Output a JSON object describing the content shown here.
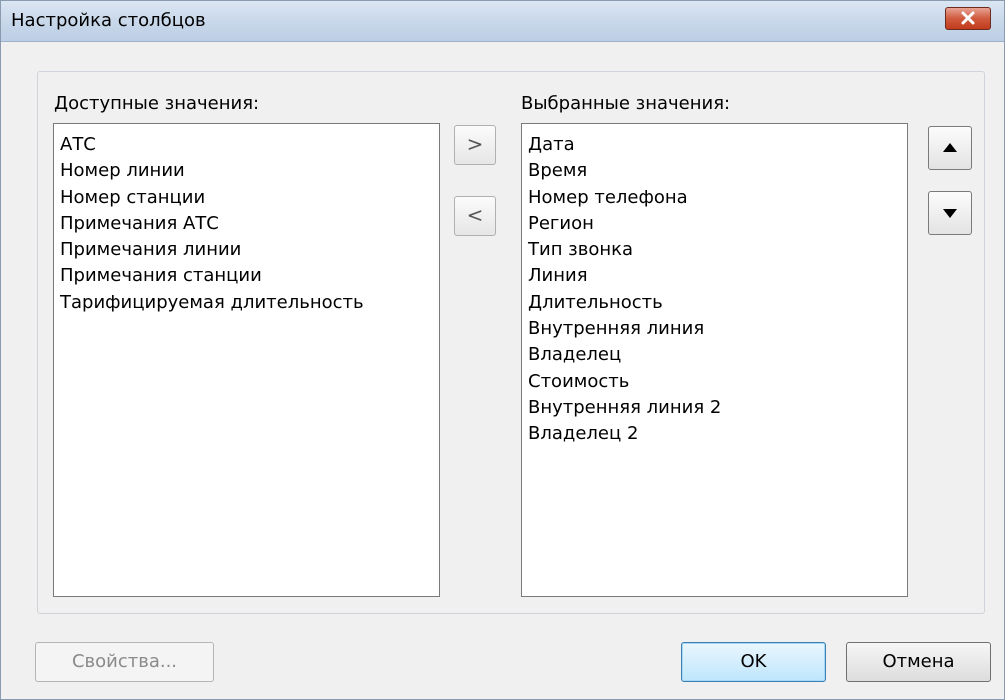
{
  "window": {
    "title": "Настройка столбцов"
  },
  "available": {
    "label": "Доступные значения:",
    "items": [
      "АТС",
      "Номер линии",
      "Номер станции",
      "Примечания АТС",
      "Примечания линии",
      "Примечания станции",
      "Тарифицируемая длительность"
    ]
  },
  "selected": {
    "label": "Выбранные значения:",
    "items": [
      "Дата",
      "Время",
      "Номер телефона",
      "Регион",
      "Тип звонка",
      "Линия",
      "Длительность",
      "Внутренняя линия",
      "Владелец",
      "Стоимость",
      "Внутренняя линия 2",
      "Владелец 2"
    ]
  },
  "transfer": {
    "add": ">",
    "remove": "<"
  },
  "buttons": {
    "properties": "Свойства...",
    "ok": "OK",
    "cancel": "Отмена"
  },
  "icons": {
    "close": "close-icon",
    "up": "triangle-up-icon",
    "down": "triangle-down-icon"
  }
}
